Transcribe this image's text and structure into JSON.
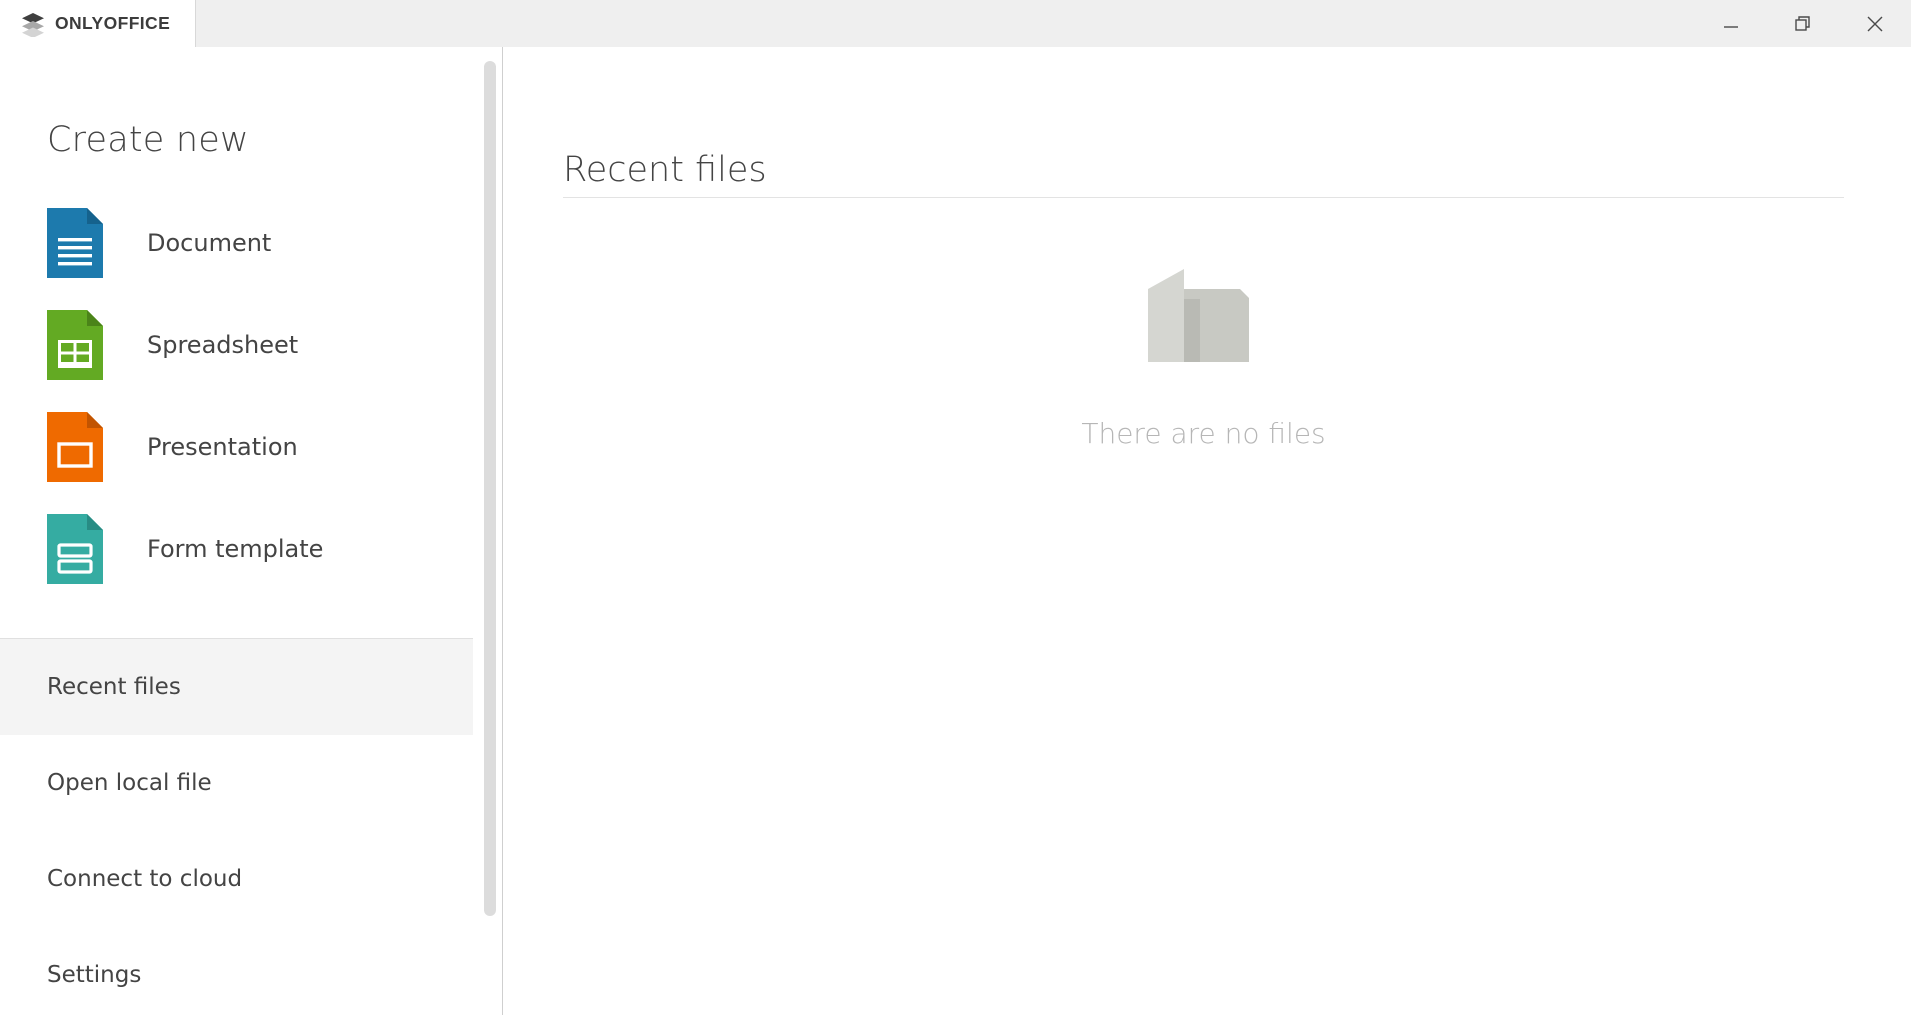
{
  "app": {
    "name": "ONLYOFFICE",
    "logo_icon": "onlyoffice-layers-logo"
  },
  "titlebar": {
    "minimize_label": "Minimize",
    "restore_label": "Restore",
    "close_label": "Close",
    "minimize_icon": "minimize-icon",
    "restore_icon": "restore-icon",
    "close_icon": "close-icon"
  },
  "sidebar": {
    "create_new": {
      "title": "Create new",
      "items": [
        {
          "label": "Document",
          "icon": "document-file-icon",
          "color": "#1d7aad"
        },
        {
          "label": "Spreadsheet",
          "icon": "spreadsheet-file-icon",
          "color": "#63aa23"
        },
        {
          "label": "Presentation",
          "icon": "presentation-file-icon",
          "color": "#ef6a00"
        },
        {
          "label": "Form template",
          "icon": "form-template-icon",
          "color": "#35aca2"
        }
      ]
    },
    "nav": {
      "items": [
        {
          "label": "Recent files",
          "active": true
        },
        {
          "label": "Open local file",
          "active": false
        },
        {
          "label": "Connect to cloud",
          "active": false
        },
        {
          "label": "Settings",
          "active": false
        }
      ]
    },
    "scrollbar": {
      "name": "sidebar-scrollbar"
    }
  },
  "main": {
    "title": "Recent files",
    "empty_state": {
      "icon": "empty-folder-icon",
      "message": "There are no files"
    }
  },
  "colors": {
    "titlebar_bg": "#efefef",
    "active_nav_bg": "#f4f4f4",
    "text": "#444444",
    "muted_text": "#b6b6b6",
    "divider": "#e3e3e3"
  }
}
